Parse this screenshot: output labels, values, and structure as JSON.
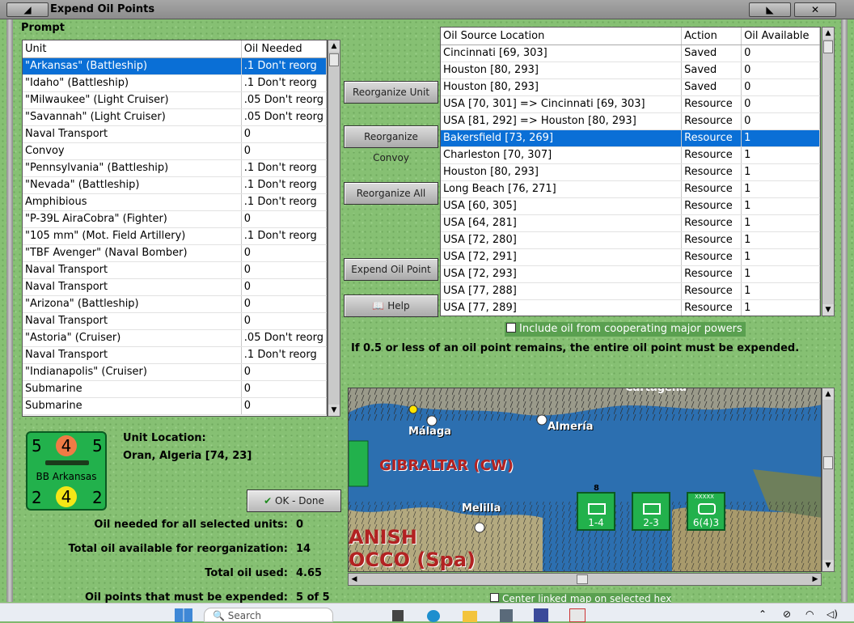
{
  "window": {
    "title": "Expend Oil Points",
    "prompt_label": "Prompt"
  },
  "units_table": {
    "headers": [
      "Unit",
      "Oil Needed"
    ],
    "rows": [
      [
        "\"Arkansas\" (Battleship)",
        ".1 Don't reorg"
      ],
      [
        "\"Idaho\" (Battleship)",
        ".1 Don't reorg"
      ],
      [
        "\"Milwaukee\" (Light Cruiser)",
        ".05 Don't reorg"
      ],
      [
        "\"Savannah\" (Light Cruiser)",
        ".05 Don't reorg"
      ],
      [
        "Naval Transport",
        "0"
      ],
      [
        "Convoy",
        "0"
      ],
      [
        "\"Pennsylvania\" (Battleship)",
        ".1 Don't reorg"
      ],
      [
        "\"Nevada\" (Battleship)",
        ".1 Don't reorg"
      ],
      [
        "Amphibious",
        ".1 Don't reorg"
      ],
      [
        "\"P-39L AiraCobra\" (Fighter)",
        "0"
      ],
      [
        "\"105 mm\" (Mot. Field Artillery)",
        ".1 Don't reorg"
      ],
      [
        "\"TBF Avenger\" (Naval Bomber)",
        "0"
      ],
      [
        "Naval Transport",
        "0"
      ],
      [
        "Naval Transport",
        "0"
      ],
      [
        "\"Arizona\" (Battleship)",
        "0"
      ],
      [
        "Naval Transport",
        "0"
      ],
      [
        "\"Astoria\" (Cruiser)",
        ".05 Don't reorg"
      ],
      [
        "Naval Transport",
        ".1 Don't reorg"
      ],
      [
        "\"Indianapolis\" (Cruiser)",
        "0"
      ],
      [
        "Submarine",
        "0"
      ],
      [
        "Submarine",
        "0"
      ]
    ],
    "selected_index": 0
  },
  "sources_table": {
    "headers": [
      "Oil Source Location",
      "Action",
      "Oil Available"
    ],
    "rows": [
      [
        "Cincinnati [69, 303]",
        "Saved",
        "0"
      ],
      [
        "Houston [80, 293]",
        "Saved",
        "0"
      ],
      [
        "Houston [80, 293]",
        "Saved",
        "0"
      ],
      [
        "USA [70, 301] => Cincinnati [69, 303]",
        "Resource",
        "0"
      ],
      [
        "USA [81, 292] => Houston [80, 293]",
        "Resource",
        "0"
      ],
      [
        "Bakersfield [73, 269]",
        "Resource",
        "1"
      ],
      [
        "Charleston [70, 307]",
        "Resource",
        "1"
      ],
      [
        "Houston [80, 293]",
        "Resource",
        "1"
      ],
      [
        "Long Beach [76, 271]",
        "Resource",
        "1"
      ],
      [
        "USA [60, 305]",
        "Resource",
        "1"
      ],
      [
        "USA [64, 281]",
        "Resource",
        "1"
      ],
      [
        "USA [72, 280]",
        "Resource",
        "1"
      ],
      [
        "USA [72, 291]",
        "Resource",
        "1"
      ],
      [
        "USA [72, 293]",
        "Resource",
        "1"
      ],
      [
        "USA [77, 288]",
        "Resource",
        "1"
      ],
      [
        "USA [77, 289]",
        "Resource",
        "1"
      ]
    ],
    "selected_index": 5
  },
  "buttons": {
    "reorganize_unit": "Reorganize Unit",
    "reorganize_convoy": "Reorganize Convoy",
    "reorganize_all": "Reorganize All",
    "expend_oil_point": "Expend Oil Point",
    "help": "Help",
    "ok_done": "OK - Done"
  },
  "include_oil_checkbox": {
    "label": "Include oil from cooperating major powers",
    "checked": false
  },
  "rule_text": "If 0.5 or less of an oil point remains, the entire oil point must be expended.",
  "counter": {
    "top_left": "5",
    "top_mid": "4",
    "top_right": "5",
    "name": "BB Arkansas",
    "bot_left": "2",
    "bot_mid": "4",
    "bot_right": "2"
  },
  "unit_location": {
    "label": "Unit Location:",
    "value": "Oran, Algeria [74, 23]"
  },
  "summary": {
    "oil_needed_label": "Oil needed for all selected units:",
    "oil_needed_value": "0",
    "total_available_label": "Total oil available for reorganization:",
    "total_available_value": "14",
    "total_used_label": "Total oil used:",
    "total_used_value": "4.65",
    "must_expend_label": "Oil points that must be expended:",
    "must_expend_value": "5 of 5"
  },
  "map": {
    "labels": {
      "malaga": "Málaga",
      "almeria": "Almería",
      "gibraltar": "GIBRALTAR (CW)",
      "melilla": "Melilla",
      "spanish": "ANISH",
      "morocco": "OCCO (Spa)",
      "cartagena": "Cartagena"
    },
    "units": [
      {
        "top": "8",
        "bottom": "1-4"
      },
      {
        "top": "",
        "bottom": "2-3"
      },
      {
        "top": "XXXXX",
        "bottom": "6(4)3"
      }
    ],
    "center_linked_label": "Center linked map on selected hex"
  },
  "taskbar": {
    "search_placeholder": "Search"
  },
  "colors": {
    "selection": "#0a6fd6",
    "counter_green": "#22b14c",
    "sea": "#2c6fb0",
    "land": "#a89a6c"
  }
}
